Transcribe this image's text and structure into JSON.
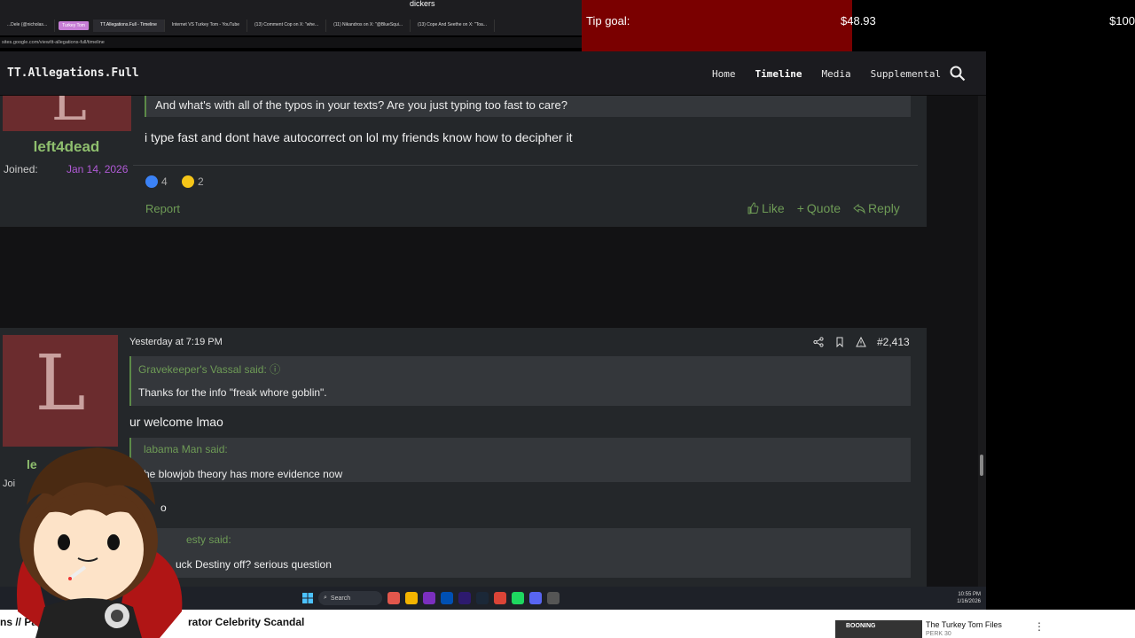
{
  "browser": {
    "window_title": "dickers",
    "tabs": [
      "...Dele (@nicholas...",
      "Turkey Tom",
      "TT.Allegations.Full - Timeline",
      "Internet VS Turkey Tom - YouTube",
      "(13) Comment Cop on X: \"whe...",
      "(11) Nikandros on X: \"@BlueSqui...",
      "(13) Cope And Seethe on X: \"Toa..."
    ],
    "url": "sites.google.com/view/tt-allegations-full/timeline"
  },
  "tip_goal": {
    "label": "Tip goal:",
    "current": "$48.93",
    "target": "$100",
    "progress_fraction": 0.4893,
    "fill_color": "#7a0000"
  },
  "site": {
    "brand": "TT.Allegations.Full",
    "nav": [
      "Home",
      "Timeline",
      "Media",
      "Supplemental"
    ],
    "active_nav": "Timeline",
    "search_icon": "search-icon"
  },
  "post1": {
    "username": "left4dead",
    "avatar_letter": "L",
    "joined_label": "Joined:",
    "joined_date": "Jan 14, 2026",
    "quote_text": "And what's with all of the typos in your texts? Are you just typing too fast to care?",
    "message": "i type fast and dont have autocorrect on lol my friends know how to decipher it",
    "reactions": [
      {
        "icon": "like-reaction-icon",
        "count": "4",
        "color": "#3b82f6"
      },
      {
        "icon": "thinking-reaction-icon",
        "count": "2",
        "color": "#f5c518"
      }
    ],
    "report": "Report",
    "actions": {
      "like": "Like",
      "quote": "Quote",
      "reply": "Reply"
    }
  },
  "post2": {
    "avatar_letter": "L",
    "username_fragment": "le",
    "joined_fragment": "Joi",
    "timestamp": "Yesterday at 7:19 PM",
    "post_number": "#2,413",
    "quotes": [
      {
        "author": "Gravekeeper's Vassal said:",
        "body": "Thanks for the info \"freak whore goblin\"."
      },
      {
        "author": "labama Man said:",
        "body": "he blowjob theory has more evidence now"
      },
      {
        "author": "esty said:",
        "body": "uck Destiny off? serious question"
      }
    ],
    "reply1": "ur welcome lmao",
    "reply2_fragment": "o"
  },
  "taskbar": {
    "search_label": "Search",
    "time": "10:55 PM",
    "date": "1/16/2026"
  },
  "ticker": {
    "left_text": "ns // Papa",
    "middle_text": "rator Celebrity Scandal",
    "thumb_text": "BOONING",
    "video_title": "The Turkey Tom Files",
    "video_sub": "PERK 30"
  }
}
